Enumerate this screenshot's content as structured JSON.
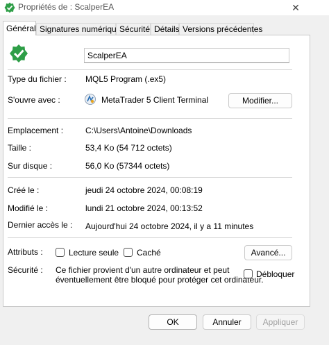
{
  "window": {
    "title": "Propriétés de : ScalperEA",
    "close_glyph": "✕"
  },
  "tabs": [
    {
      "label": "Général"
    },
    {
      "label": "Signatures numériques"
    },
    {
      "label": "Sécurité"
    },
    {
      "label": "Détails"
    },
    {
      "label": "Versions précédentes"
    }
  ],
  "general": {
    "file_name": "ScalperEA",
    "file_type_label": "Type du fichier :",
    "file_type_value": "MQL5 Program (.ex5)",
    "opens_with_label": "S'ouvre avec :",
    "opens_with_value": "MetaTrader 5 Client Terminal",
    "change_button": "Modifier...",
    "location_label": "Emplacement :",
    "location_value": "C:\\Users\\Antoine\\Downloads",
    "size_label": "Taille :",
    "size_value": "53,4 Ko (54 712 octets)",
    "disk_size_label": "Sur disque :",
    "disk_size_value": "56,0 Ko (57344 octets)",
    "created_label": "Créé le :",
    "created_value": "jeudi 24 octobre 2024, 00:08:19",
    "modified_label": "Modifié le :",
    "modified_value": "lundi 21 octobre 2024, 00:13:52",
    "accessed_label": "Dernier accès le :",
    "accessed_value": "Aujourd'hui 24 octobre 2024, il y a 11 minutes",
    "attributes_label": "Attributs :",
    "readonly_label": "Lecture seule",
    "hidden_label": "Caché",
    "advanced_button": "Avancé...",
    "security_label": "Sécurité :",
    "security_text_line1": "Ce fichier provient d'un autre ordinateur et peut",
    "security_text_line2": "éventuellement être bloqué pour protéger cet ordinateur.",
    "unblock_label": "Débloquer"
  },
  "footer": {
    "ok": "OK",
    "cancel": "Annuler",
    "apply": "Appliquer"
  },
  "colors": {
    "icon_green": "#2e9e47",
    "accent": "#0067c0"
  }
}
